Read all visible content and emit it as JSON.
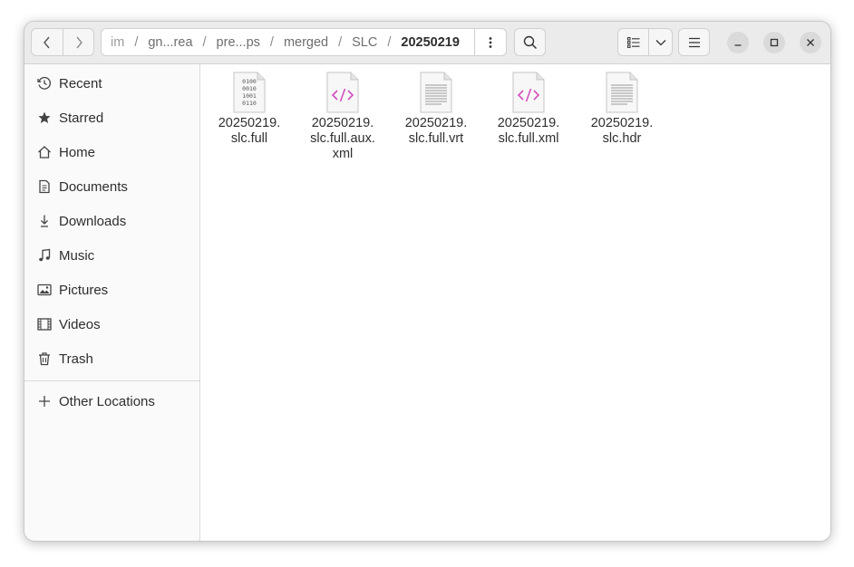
{
  "header": {
    "breadcrumbs": [
      "im",
      "gn...rea",
      "pre...ps",
      "merged",
      "SLC"
    ],
    "current": "20250219",
    "separator": "/"
  },
  "sidebar": {
    "items": [
      {
        "label": "Recent",
        "icon": "clock-icon"
      },
      {
        "label": "Starred",
        "icon": "star-icon"
      },
      {
        "label": "Home",
        "icon": "home-icon"
      },
      {
        "label": "Documents",
        "icon": "document-icon"
      },
      {
        "label": "Downloads",
        "icon": "download-icon"
      },
      {
        "label": "Music",
        "icon": "music-icon"
      },
      {
        "label": "Pictures",
        "icon": "picture-icon"
      },
      {
        "label": "Videos",
        "icon": "video-icon"
      },
      {
        "label": "Trash",
        "icon": "trash-icon"
      }
    ],
    "other_locations": {
      "label": "Other Locations",
      "icon": "plus-icon"
    }
  },
  "files": [
    {
      "name": "20250219.\nslc.full",
      "type": "binary"
    },
    {
      "name": "20250219.\nslc.full.aux.\nxml",
      "type": "xml"
    },
    {
      "name": "20250219.\nslc.full.vrt",
      "type": "text"
    },
    {
      "name": "20250219.\nslc.full.xml",
      "type": "xml"
    },
    {
      "name": "20250219.\nslc.hdr",
      "type": "text"
    }
  ],
  "colors": {
    "xml_glyph": "#d24fc0",
    "icon_gray": "#5e5e5e"
  }
}
